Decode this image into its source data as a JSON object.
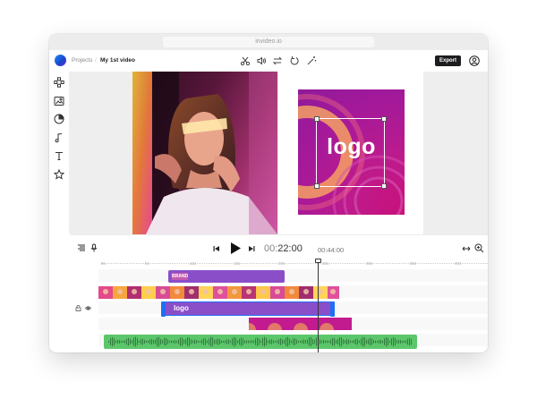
{
  "browser": {
    "url": "invideo.io"
  },
  "header": {
    "breadcrumb": {
      "root": "Projects",
      "separator": "/",
      "current": "My 1st video"
    },
    "tools": [
      "cut-icon",
      "volume-icon",
      "swap-icon",
      "undo-icon",
      "magic-wand-icon"
    ],
    "export_label": "Export"
  },
  "sidebar": {
    "items": [
      "layout-icon",
      "media-icon",
      "sticker-icon",
      "music-icon",
      "text-icon",
      "star-icon"
    ]
  },
  "canvas": {
    "logo_text": "logo"
  },
  "timeline": {
    "current_time_prefix": "00:",
    "current_time_main": "22:00",
    "total_time": "00:44:00",
    "ruler": [
      "0s",
      "5s",
      "10s",
      "15s",
      "20s",
      "25s",
      "30s",
      "35s",
      "40s"
    ],
    "clips": {
      "brand_label": "BRAND",
      "logo_label": "logo"
    }
  },
  "colors": {
    "accent": "#1f6ff5",
    "text_clip": "#8b4ec9",
    "logo_background": "#b5188f",
    "audio_clip": "#5cc66b",
    "export_button": "#1d1d1f"
  }
}
